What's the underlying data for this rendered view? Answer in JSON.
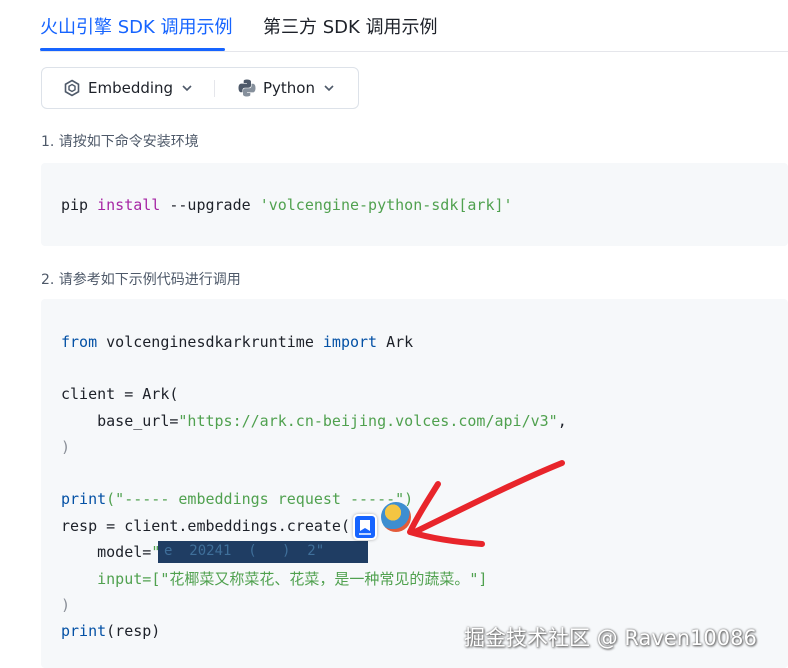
{
  "tabs": [
    {
      "label": "火山引擎 SDK 调用示例",
      "active": true
    },
    {
      "label": "第三方 SDK 调用示例",
      "active": false
    }
  ],
  "selectors": {
    "model": {
      "label": "Embedding",
      "icon": "embedding-model-icon"
    },
    "language": {
      "label": "Python",
      "icon": "python-icon"
    },
    "chevron_icon": "chevron-down-icon"
  },
  "steps": {
    "step1": "1. 请按如下命令安装环境",
    "step2": "2. 请参考如下示例代码进行调用"
  },
  "install_code": {
    "cmd": "pip",
    "install": "install",
    "flag": "--upgrade",
    "package": "'volcengine-python-sdk[ark]'"
  },
  "sample_code": {
    "from": "from",
    "module": "volcenginesdkarkruntime",
    "import": "import",
    "ark": "Ark",
    "client_assign": "client = Ark(",
    "base_url_key": "base_url=",
    "base_url_val": "\"https://ark.cn-beijing.volces.com/api/v3\"",
    "comma": ",",
    "close_paren": ")",
    "print": "print",
    "print_str": "(\"----- embeddings request -----\")",
    "resp_line": "resp = client.embeddings.create(",
    "model_key": "model=",
    "model_prefix": "\"",
    "model_redacted_visible": "e  20241  (   )  2\"",
    "input_key": "input=",
    "input_val": "[\"花椰菜又称菜花、花菜，是一种常见的蔬菜。\"]",
    "print_resp": "(resp)"
  },
  "overlay": {
    "app_icon": "app-shortcut-icon",
    "arrow_color": "#e8252b"
  },
  "watermark": "掘金技术社区 @ Raven10086",
  "colors": {
    "accent": "#1664ff",
    "keyword": "#0451a5",
    "string": "#50a14f",
    "function": "#a626a4",
    "code_bg": "#f6f8fa"
  }
}
